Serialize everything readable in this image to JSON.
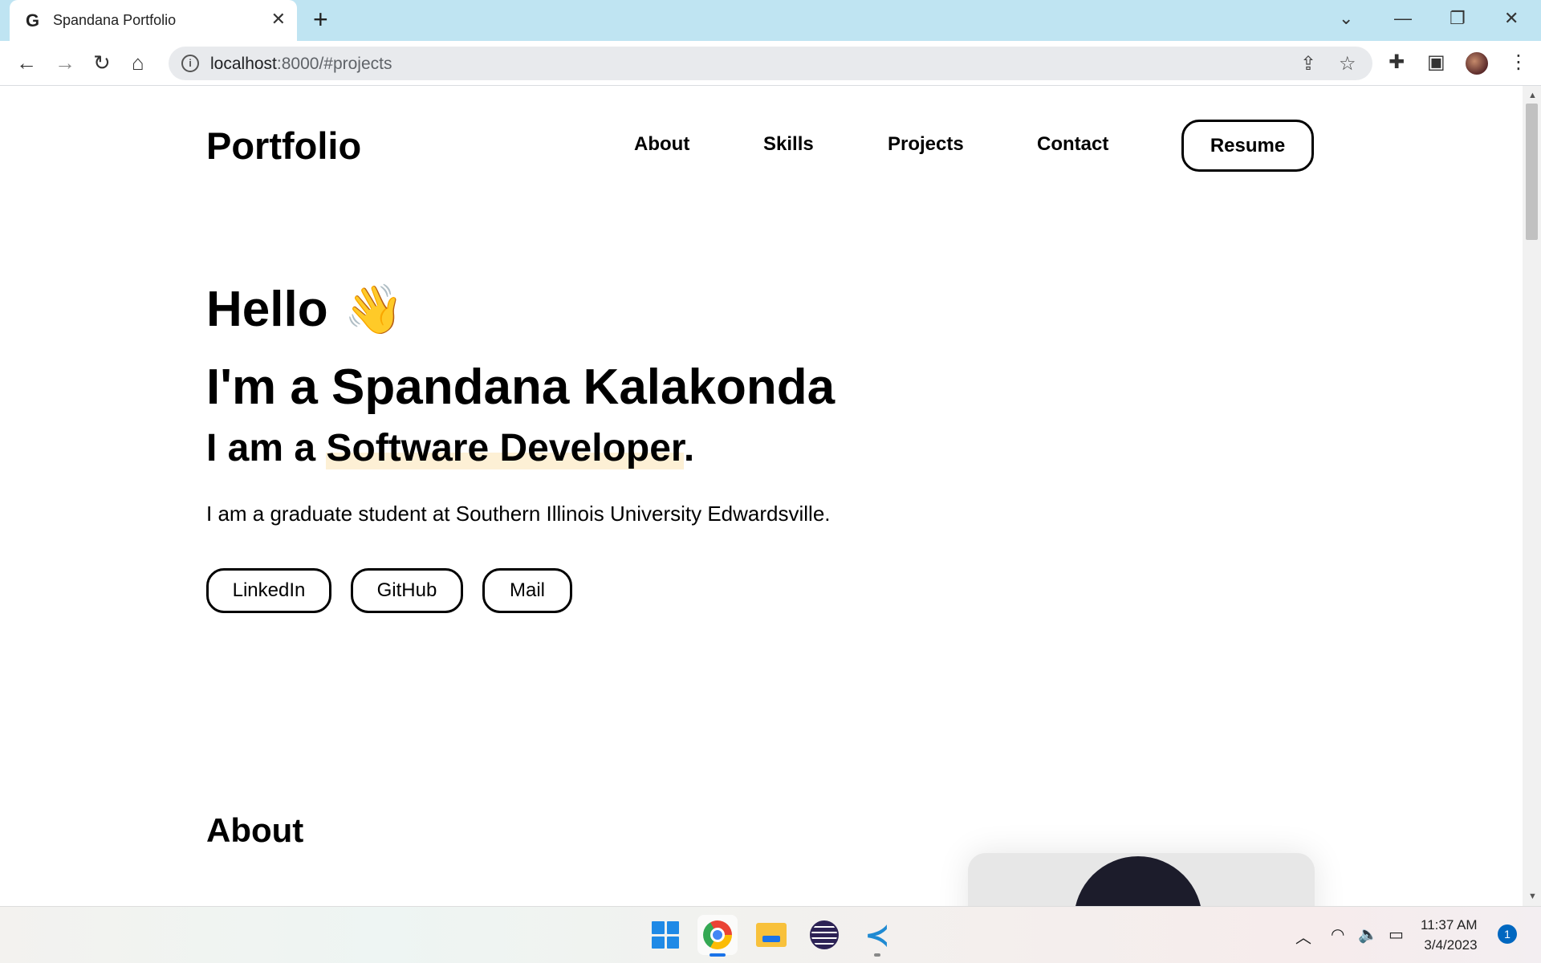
{
  "browser": {
    "tab_title": "Spandana Portfolio",
    "tab_favicon": "G",
    "url_host": "localhost",
    "url_rest": ":8000/#projects",
    "icons": [
      "back-icon",
      "forward-icon",
      "reload-icon",
      "home-icon",
      "info-icon",
      "share-icon",
      "star-icon",
      "extensions-icon",
      "side-panel-icon",
      "menu-icon"
    ]
  },
  "site": {
    "brand": "Portfolio",
    "nav": {
      "about": "About",
      "skills": "Skills",
      "projects": "Projects",
      "contact": "Contact",
      "resume": "Resume"
    },
    "hero": {
      "hello": "Hello",
      "wave": "👋",
      "name": "I'm a Spandana Kalakonda",
      "role_prefix": "I am a ",
      "role_highlight": "Software Developer",
      "role_suffix": ".",
      "description": "I am a graduate student at Southern Illinois University Edwardsville."
    },
    "social": {
      "linkedin": "LinkedIn",
      "github": "GitHub",
      "mail": "Mail"
    },
    "about_title": "About"
  },
  "taskbar": {
    "apps": [
      "windows-start",
      "chrome",
      "file-explorer",
      "eclipse",
      "vscode"
    ],
    "time": "11:37 AM",
    "date": "3/4/2023",
    "notifications": "1"
  },
  "colors": {
    "tabstrip": "#bfe4f2",
    "highlight": "#fdf0d5",
    "scrollbar_thumb": "#c1c1c1"
  }
}
